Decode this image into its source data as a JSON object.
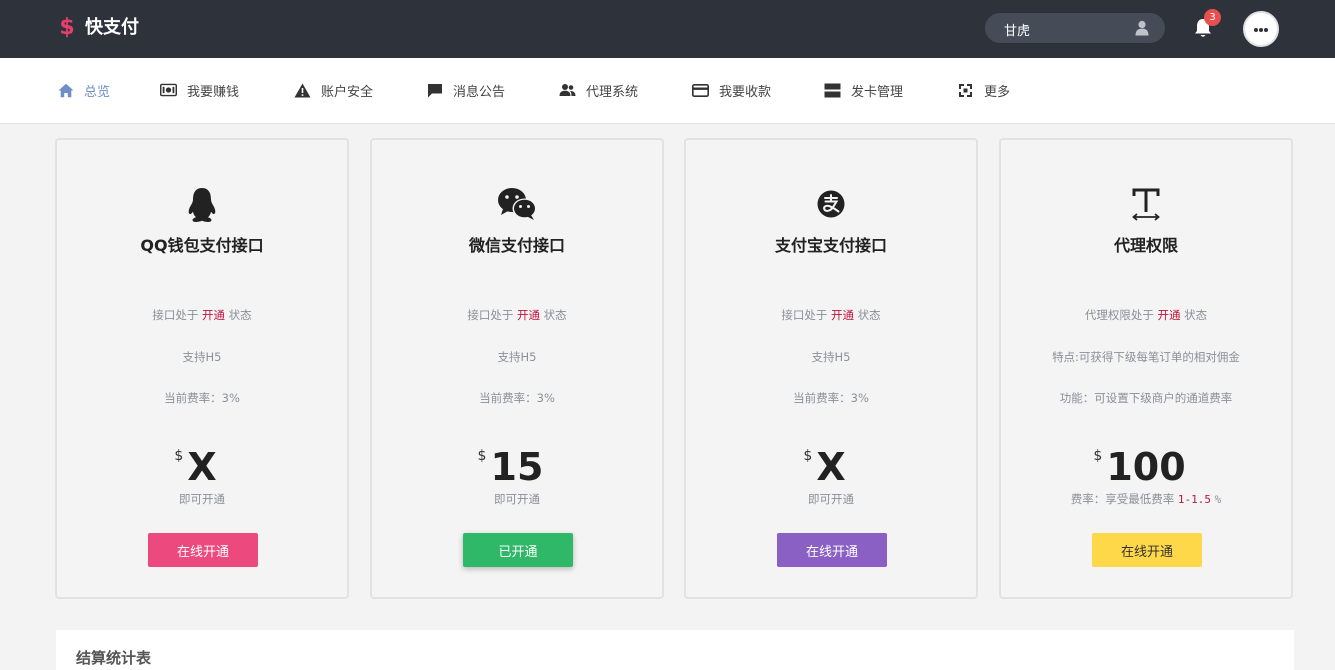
{
  "brand": {
    "logo_symbol": "$",
    "name": "快支付",
    "accent": "#e83e6c"
  },
  "topbar": {
    "user_name": "甘虎",
    "notification_count": "3"
  },
  "nav": {
    "items": [
      {
        "label": "总览",
        "icon": "home-icon",
        "active": true
      },
      {
        "label": "我要赚钱",
        "icon": "money-icon"
      },
      {
        "label": "账户安全",
        "icon": "warning-icon"
      },
      {
        "label": "消息公告",
        "icon": "message-icon"
      },
      {
        "label": "代理系统",
        "icon": "users-icon"
      },
      {
        "label": "我要收款",
        "icon": "credit-card-icon"
      },
      {
        "label": "发卡管理",
        "icon": "cards-icon"
      },
      {
        "label": "更多",
        "icon": "expand-icon"
      }
    ]
  },
  "cards": [
    {
      "icon": "qq-icon",
      "title": "QQ钱包支付接口",
      "status_prefix": "接口处于",
      "status": "开通",
      "status_suffix": "状态",
      "line2": "支持H5",
      "line3": "当前费率：3%",
      "currency": "$",
      "price": "X",
      "price_note": "即可开通",
      "button": "在线开通",
      "button_color": "#ec4a7f"
    },
    {
      "icon": "wechat-icon",
      "title": "微信支付接口",
      "status_prefix": "接口处于",
      "status": "开通",
      "status_suffix": "状态",
      "line2": "支持H5",
      "line3": "当前费率：3%",
      "currency": "$",
      "price": "15",
      "price_note": "即可开通",
      "button": "已开通",
      "button_color": "#2fb868"
    },
    {
      "icon": "alipay-icon",
      "title": "支付宝支付接口",
      "status_prefix": "接口处于",
      "status": "开通",
      "status_suffix": "状态",
      "line2": "支持H5",
      "line3": "当前费率：3%",
      "currency": "$",
      "price": "X",
      "price_note": "即可开通",
      "button": "在线开通",
      "button_color": "#8a60c4"
    },
    {
      "icon": "text-icon",
      "title": "代理权限",
      "status_prefix": "代理权限处于",
      "status": "开通",
      "status_suffix": "状态",
      "line2": "特点:可获得下级每笔订单的相对佣金",
      "line3": "功能：可设置下级商户的通道费率",
      "currency": "$",
      "price": "100",
      "price_note_prefix": "费率：享受最低费率",
      "price_note_range": "1-1.5",
      "price_note_suffix": "%",
      "button": "在线开通",
      "button_color": "#ffd84a"
    }
  ],
  "panel": {
    "title": "结算统计表"
  }
}
